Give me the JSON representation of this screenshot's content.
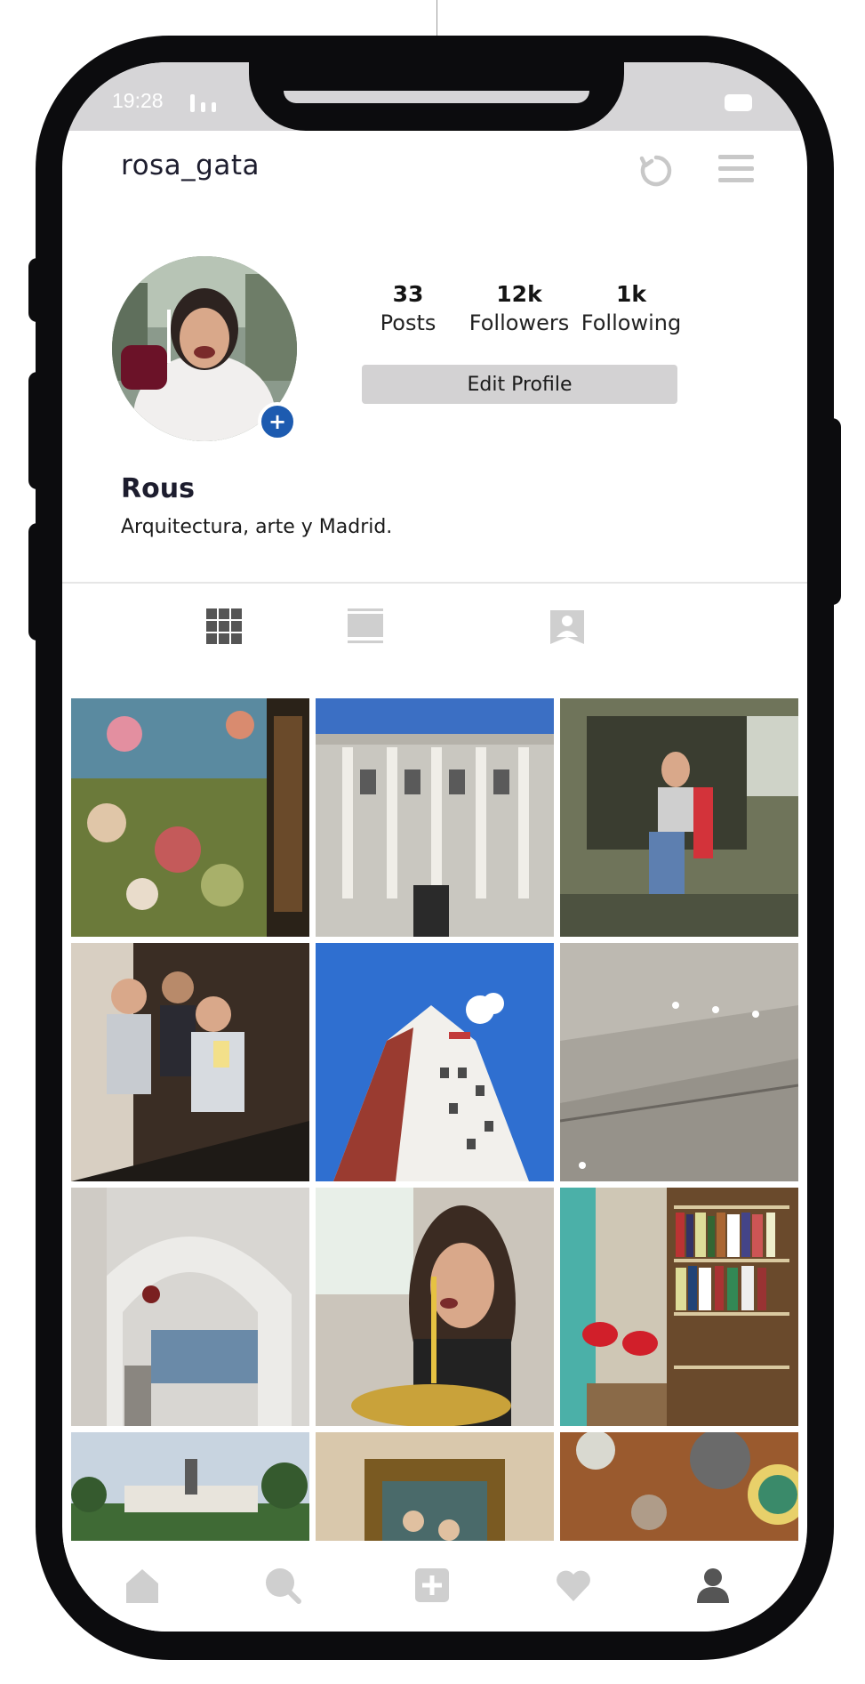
{
  "status_bar": {
    "time": "19:28"
  },
  "header": {
    "username": "rosa_gata",
    "icons": [
      "refresh-icon",
      "menu-icon"
    ]
  },
  "profile": {
    "display_name": "Rous",
    "bio": "Arquitectura, arte y Madrid.",
    "stats": [
      {
        "value": "33",
        "label": "Posts"
      },
      {
        "value": "12k",
        "label": "Followers"
      },
      {
        "value": "1k",
        "label": "Following"
      }
    ],
    "edit_button": "Edit Profile",
    "add_story_glyph": "+"
  },
  "tabs": [
    "grid-icon",
    "feed-icon",
    "tagged-icon"
  ],
  "posts": [
    "painting-garden-of-earthly-delights",
    "royal-palace-facade",
    "woman-in-military-truck",
    "three-friends-selfie-mirror",
    "edificio-espana-tower",
    "concrete-staircase-interior",
    "palacio-cibeles-arches",
    "woman-eating-pasta",
    "bookshop-with-red-lamp",
    "retiro-monument",
    "framed-painting",
    "table-with-plates"
  ],
  "bottom_nav": [
    "home-icon",
    "search-icon",
    "add-icon",
    "heart-icon",
    "profile-icon"
  ],
  "colors": {
    "accent_blue": "#1d5bb0",
    "phone_frame": "#0c0c0e",
    "status_bar": "#d6d5d7",
    "button_gray": "#d3d2d3",
    "icon_gray": "#c8c8c8",
    "active_nav": "#555555"
  }
}
